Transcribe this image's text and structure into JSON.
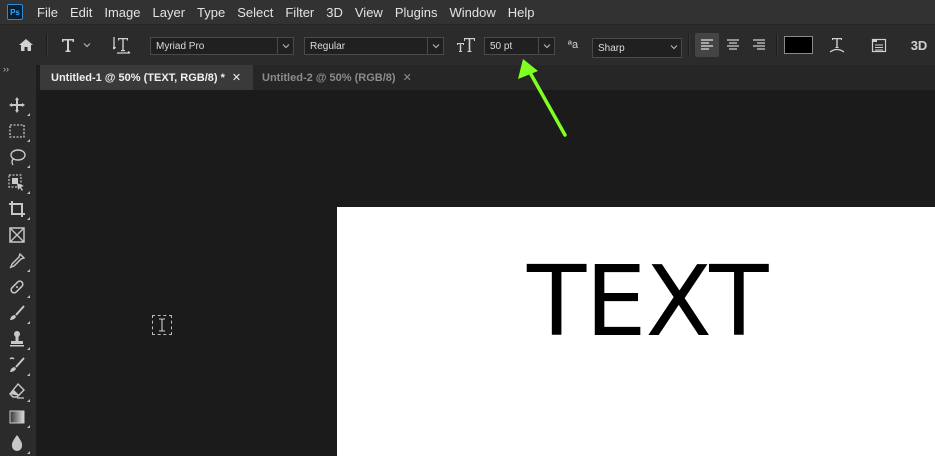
{
  "app": {
    "logo_text": "Ps"
  },
  "menu": [
    "File",
    "Edit",
    "Image",
    "Layer",
    "Type",
    "Select",
    "Filter",
    "3D",
    "View",
    "Plugins",
    "Window",
    "Help"
  ],
  "options": {
    "font_family": "Myriad Pro",
    "font_style": "Regular",
    "font_size": "50 pt",
    "antialias_icon_text": "ªa",
    "antialias": "Sharp",
    "text_color": "#000000",
    "three_d_label": "3D"
  },
  "tabs": [
    {
      "label": "Untitled-1 @ 50% (TEXT, RGB/8) *",
      "active": true
    },
    {
      "label": "Untitled-2 @ 50% (RGB/8)",
      "active": false
    }
  ],
  "toolbar": {
    "collapse_label": "››",
    "tools": [
      "move-tool",
      "marquee-tool",
      "lasso-tool",
      "object-selection-tool",
      "crop-tool",
      "frame-tool",
      "eyedropper-tool",
      "healing-brush-tool",
      "brush-tool",
      "clone-stamp-tool",
      "history-brush-tool",
      "eraser-tool",
      "gradient-tool",
      "blur-tool"
    ]
  },
  "document": {
    "text": "TEXT"
  },
  "colors": {
    "accent_arrow": "#7fff22",
    "canvas": "#ffffff",
    "workspace": "#1b1b1b"
  }
}
